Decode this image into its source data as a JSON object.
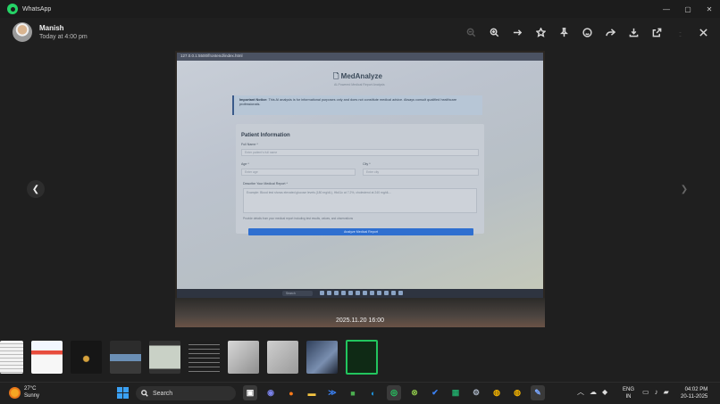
{
  "window": {
    "app_title": "WhatsApp",
    "controls": [
      "—",
      "▢",
      "✕"
    ]
  },
  "header": {
    "sender_name": "Manish",
    "timestamp": "Today at 4:00 pm"
  },
  "photo": {
    "caption": "2025.11.20 16:00",
    "url": "127.0.0.1:5500/frontend/index.html",
    "app_title": "MedAnalyze",
    "app_subtitle": "AI-Powered Medical Report Analysis",
    "notice_label": "Important Notice:",
    "notice_text": "This AI analysis is for informational purposes only and does not constitute medical advice. Always consult qualified healthcare professionals.",
    "card_title": "Patient Information",
    "full_name_label": "Full Name *",
    "full_name_placeholder": "Enter patient's full name",
    "age_label": "Age *",
    "age_placeholder": "Enter age",
    "city_label": "City *",
    "city_placeholder": "Enter city",
    "report_label": "Describe Your Medical Report *",
    "report_placeholder": "Example: Blood test shows elevated glucose levels (180 mg/dL), HbA1c at 7.2%, cholesterol at 240 mg/dL...",
    "hint": "Provide details from your medical report including test results, values, and observations",
    "analyze_button": "Analyze Medical Report",
    "mini_search": "Search"
  },
  "thumbnails": {
    "count": 10,
    "selected_index": 9
  },
  "taskbar": {
    "temperature": "27°C",
    "condition": "Sunny",
    "search_label": "Search",
    "lang_top": "ENG",
    "lang_bottom": "IN",
    "time": "04:02 PM",
    "date": "20-11-2025"
  },
  "colors": {
    "accent_whatsapp": "#25d366",
    "thumb_selected_border": "#22c55e",
    "analyze_button": "#2f6fd0"
  }
}
